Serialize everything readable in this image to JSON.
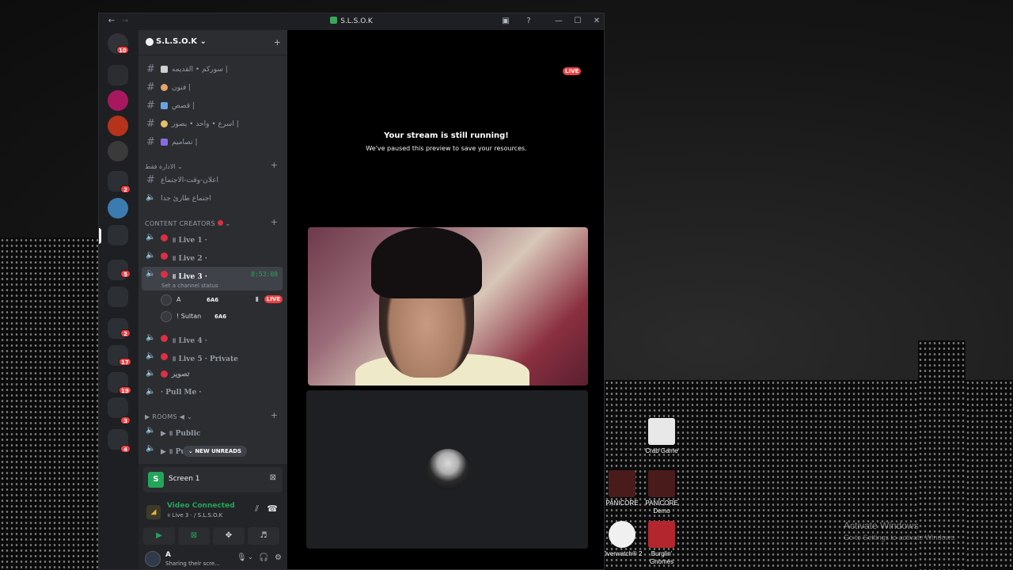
{
  "window": {
    "title": "S.L.S.O.K",
    "nav_back": "←",
    "nav_forward": "→",
    "inbox_icon": "inbox-icon",
    "help_icon": "?",
    "minimize": "—",
    "maximize": "☐",
    "close": "✕"
  },
  "rail": {
    "dm_badge": "10",
    "badges": [
      "2",
      "5",
      "2",
      "17",
      "19",
      "3",
      "4"
    ]
  },
  "server": {
    "name": "S.L.S.O.K",
    "chevron": "⌄",
    "add_member_icon": "+"
  },
  "channels": {
    "text": [
      {
        "label": "سوركم • القديمه |"
      },
      {
        "label": "فنون |"
      },
      {
        "label": "قصص |"
      },
      {
        "label": "اسرع • واحد • يصور |"
      },
      {
        "label": "تصاميم |"
      }
    ],
    "admin_category": "الادارة فقط",
    "admin_channels": [
      {
        "label": "اعلان-وقت-الاجتماع"
      },
      {
        "label": "اجتماع طارئ جدا"
      }
    ],
    "creators_category": "CONTENT CREATORS",
    "voice": [
      {
        "label": "॥ Live 1 ·"
      },
      {
        "label": "॥ Live 2 ·"
      },
      {
        "label": "॥ Live 3 ·",
        "timer": "8:53:08",
        "status": "Set a channel status"
      },
      {
        "label": "॥ Live 4 ·"
      },
      {
        "label": "॥ Live 5 · Private"
      },
      {
        "label": "تصوير"
      },
      {
        "label": "· Pull Me ·"
      }
    ],
    "users": [
      {
        "name": "A",
        "tag": "6A6",
        "live": "LIVE"
      },
      {
        "name": "! Sultan",
        "tag": "6A6"
      }
    ],
    "rooms_category": "▶ ROOMS ◀",
    "rooms": [
      {
        "label": "▶ ॥ Public"
      },
      {
        "label": "▶ ॥ Pu"
      }
    ],
    "new_unreads": "NEW UNREADS"
  },
  "voice_panel": {
    "screen_label": "Screen 1",
    "status": "Video Connected",
    "channel": "॥ Live 3 ·  / S.L.S.O.K"
  },
  "user": {
    "name": "A",
    "subtitle": "Sharing their scre..."
  },
  "stream": {
    "live": "LIVE",
    "paused_title": "Your stream is still running!",
    "paused_sub": "We've paused this preview to save your resources."
  },
  "desktop": {
    "icons": [
      {
        "label": "Crab Game"
      },
      {
        "label": "PANICORE"
      },
      {
        "label": "PANICORE Demo"
      },
      {
        "label": "Overwatch® 2"
      },
      {
        "label": "Burglin' Gnomes"
      }
    ],
    "activate_title": "Activate Windows",
    "activate_sub": "Go to Settings to activate Windows."
  },
  "colors": {
    "accent_green": "#23a55a",
    "live_red": "#f23f42",
    "sidebar": "#2b2d31",
    "rail": "#1e1f22"
  }
}
